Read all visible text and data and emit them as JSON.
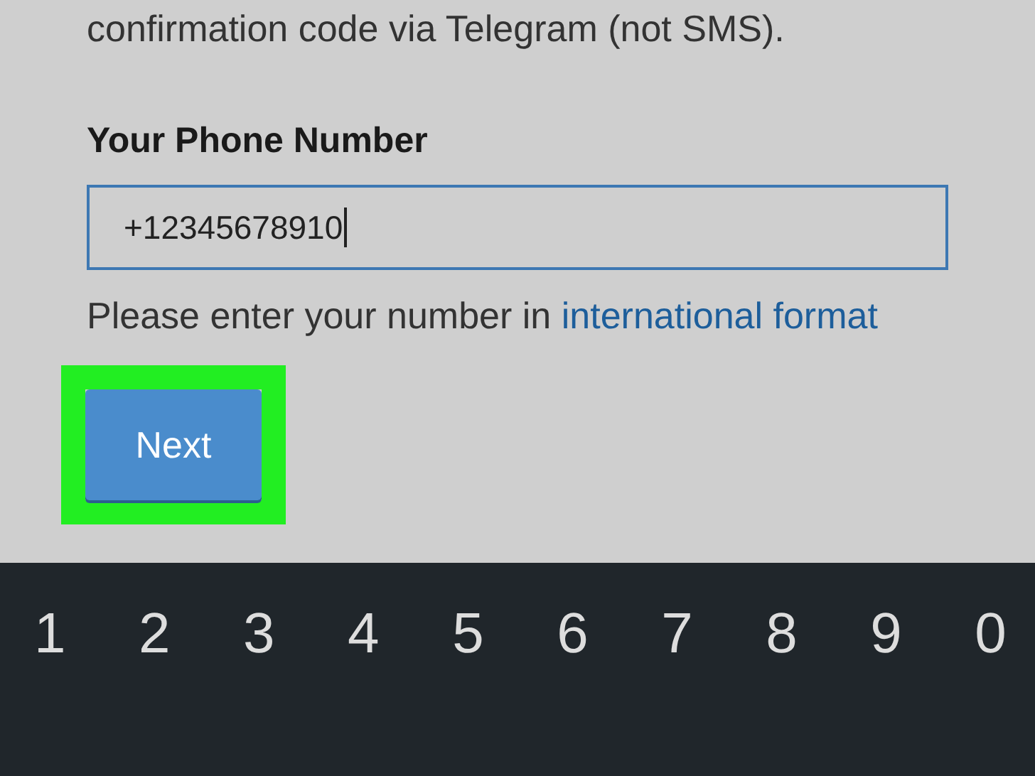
{
  "intro_text": "confirmation code via Telegram (not SMS).",
  "phone_field": {
    "label": "Your Phone Number",
    "value": "+12345678910",
    "focused": true
  },
  "hint": {
    "text": "Please enter your number in",
    "link": "international format"
  },
  "next_button": {
    "label": "Next",
    "highlighted": true
  },
  "keyboard": {
    "number_row": [
      "1",
      "2",
      "3",
      "4",
      "5",
      "6",
      "7",
      "8",
      "9",
      "0"
    ]
  }
}
